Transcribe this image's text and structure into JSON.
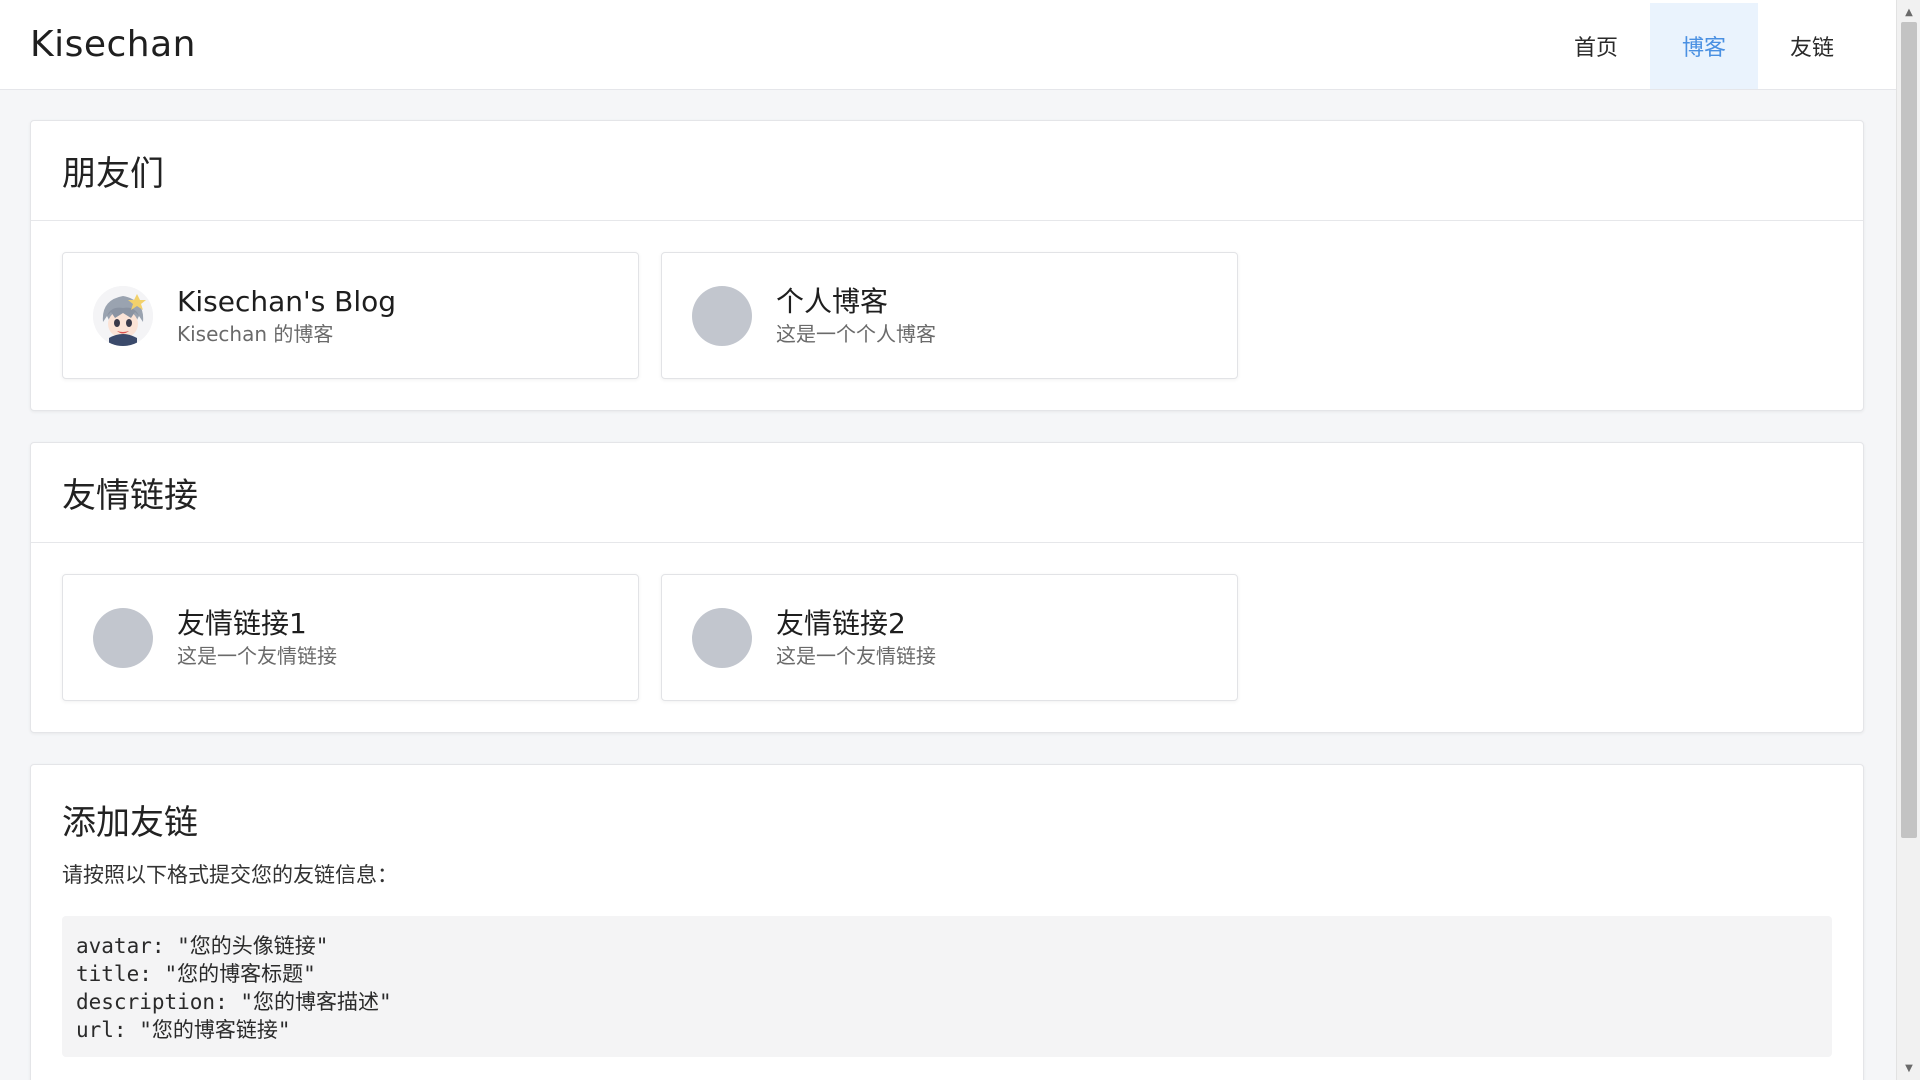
{
  "header": {
    "brand": "Kisechan",
    "nav": [
      {
        "label": "首页"
      },
      {
        "label": "博客"
      },
      {
        "label": "友链"
      }
    ]
  },
  "friends": {
    "title": "朋友们",
    "cards": [
      {
        "title": "Kisechan's Blog",
        "description": "Kisechan 的博客",
        "avatar": "anime-avatar"
      },
      {
        "title": "个人博客",
        "description": "这是一个个人博客",
        "avatar": "placeholder-avatar"
      }
    ]
  },
  "links": {
    "title": "友情链接",
    "cards": [
      {
        "title": "友情链接1",
        "description": "这是一个友情链接",
        "avatar": "placeholder-avatar"
      },
      {
        "title": "友情链接2",
        "description": "这是一个友情链接",
        "avatar": "placeholder-avatar"
      }
    ]
  },
  "add": {
    "title": "添加友链",
    "instruction": "请按照以下格式提交您的友链信息：",
    "code_lines": [
      "avatar: \"您的头像链接\"",
      "title: \"您的博客标题\"",
      "description: \"您的博客描述\"",
      "url: \"您的博客链接\""
    ]
  },
  "colors": {
    "accent": "#4a90e2",
    "active_nav_bg": "#eaf3fd",
    "avatar_placeholder": "#c2c6ce"
  }
}
